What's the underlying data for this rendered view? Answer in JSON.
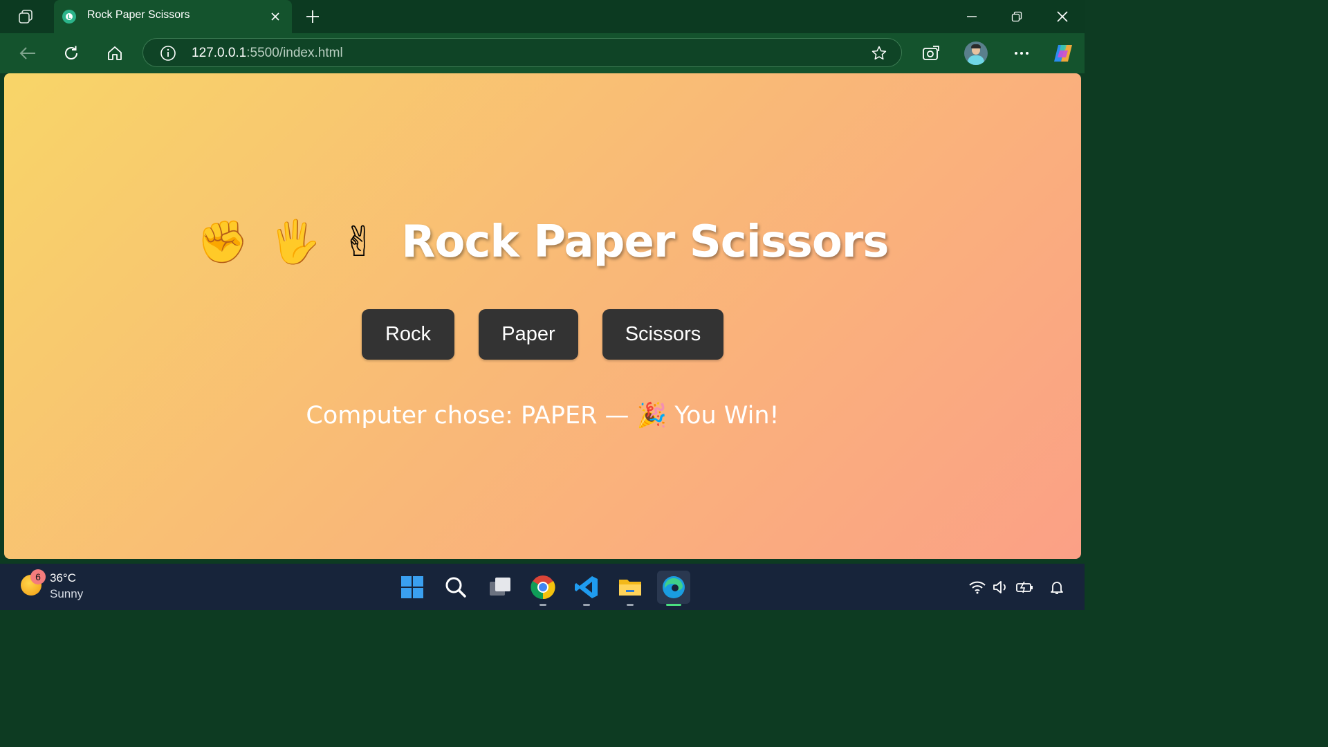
{
  "browser": {
    "tab_title": "Rock Paper Scissors",
    "url_host": "127.0.0.1",
    "url_path": ":5500/index.html"
  },
  "page": {
    "emojis": [
      "✊",
      "🖐",
      "✌"
    ],
    "title": "Rock Paper Scissors",
    "buttons": {
      "rock": "Rock",
      "paper": "Paper",
      "scissors": "Scissors"
    },
    "result": "Computer chose: PAPER — 🎉 You Win!",
    "colors": {
      "gradient_start": "#f8d568",
      "gradient_end": "#fba086",
      "button_bg": "#333333"
    }
  },
  "taskbar": {
    "weather_badge": "6",
    "temperature": "36°C",
    "condition": "Sunny",
    "apps": [
      "start-icon",
      "search-icon",
      "task-view-icon",
      "chrome-icon",
      "vscode-icon",
      "file-explorer-icon",
      "edge-icon"
    ],
    "tray": [
      "wifi-icon",
      "volume-icon",
      "battery-icon",
      "notification-bell-icon"
    ]
  }
}
